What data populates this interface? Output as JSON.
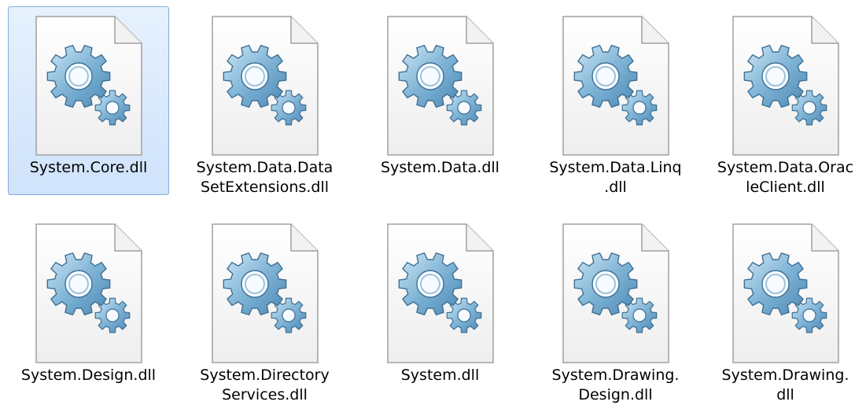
{
  "files": [
    {
      "name": "System.Core.dll",
      "selected": true
    },
    {
      "name": "System.Data.Data\nSetExtensions.dll",
      "selected": false
    },
    {
      "name": "System.Data.dll",
      "selected": false
    },
    {
      "name": "System.Data.Linq\n.dll",
      "selected": false
    },
    {
      "name": "System.Data.Orac\nleClient.dll",
      "selected": false
    },
    {
      "name": "System.Design.dll",
      "selected": false
    },
    {
      "name": "System.Directory\nServices.dll",
      "selected": false
    },
    {
      "name": "System.dll",
      "selected": false
    },
    {
      "name": "System.Drawing.\nDesign.dll",
      "selected": false
    },
    {
      "name": "System.Drawing.\ndll",
      "selected": false
    }
  ],
  "icon": "dll-gear-file-icon",
  "colors": {
    "selection_bg": "#cfe3fb",
    "selection_border": "#84acdd"
  }
}
